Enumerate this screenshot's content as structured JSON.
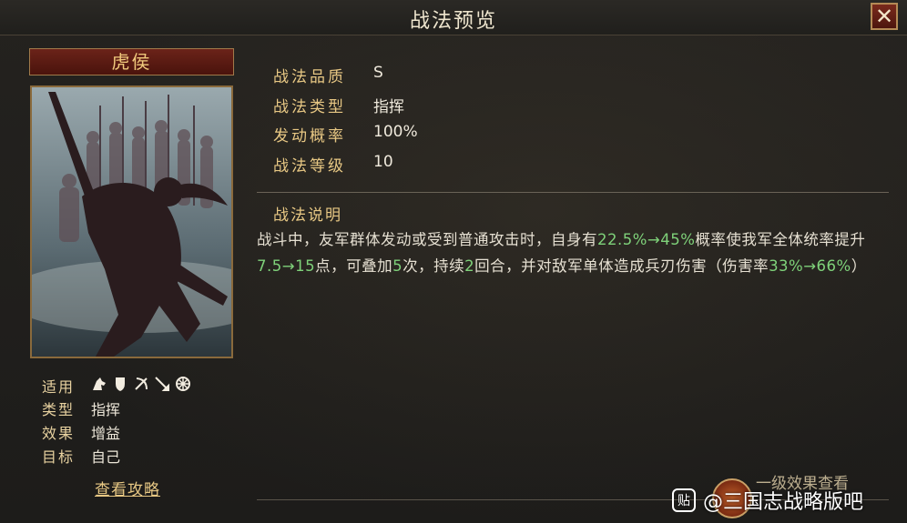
{
  "window": {
    "title": "战法预览"
  },
  "skill": {
    "name": "虎侯",
    "meta": {
      "applicable_label": "适用",
      "unit_icons": [
        "cavalry-icon",
        "shield-icon",
        "bow-icon",
        "spear-icon",
        "siege-wheel-icon"
      ],
      "type_label": "类型",
      "type_value": "指挥",
      "effect_label": "效果",
      "effect_value": "增益",
      "target_label": "目标",
      "target_value": "自己"
    },
    "guide_link": "查看攻略",
    "info": [
      {
        "key": "战法品质",
        "value": "S"
      },
      {
        "key": "战法类型",
        "value": "指挥"
      },
      {
        "key": "发动概率",
        "value": "100%"
      },
      {
        "key": "战法等级",
        "value": "10"
      }
    ],
    "description_title": "战法说明",
    "description": {
      "p1": "战斗中，友军群体发动或受到普通攻击时，自身有",
      "v1": "22.5%→45%",
      "p2": "概率使我军全体统率提升",
      "v2": "7.5→15",
      "p3": "点，可叠加",
      "v3": "5",
      "p4": "次，持续",
      "v4": "2",
      "p5": "回合，并对敌军单体造成兵刃伤害（伤害率",
      "v5": "33%→66%",
      "p6": "）"
    },
    "level_effect_link": "一级效果查看"
  },
  "watermark": {
    "badge": "贴",
    "text": "@三国志战略版吧"
  },
  "colors": {
    "accent_gold": "#e8c884",
    "growth_green": "#7fd27a",
    "title_red": "#6b2319"
  }
}
